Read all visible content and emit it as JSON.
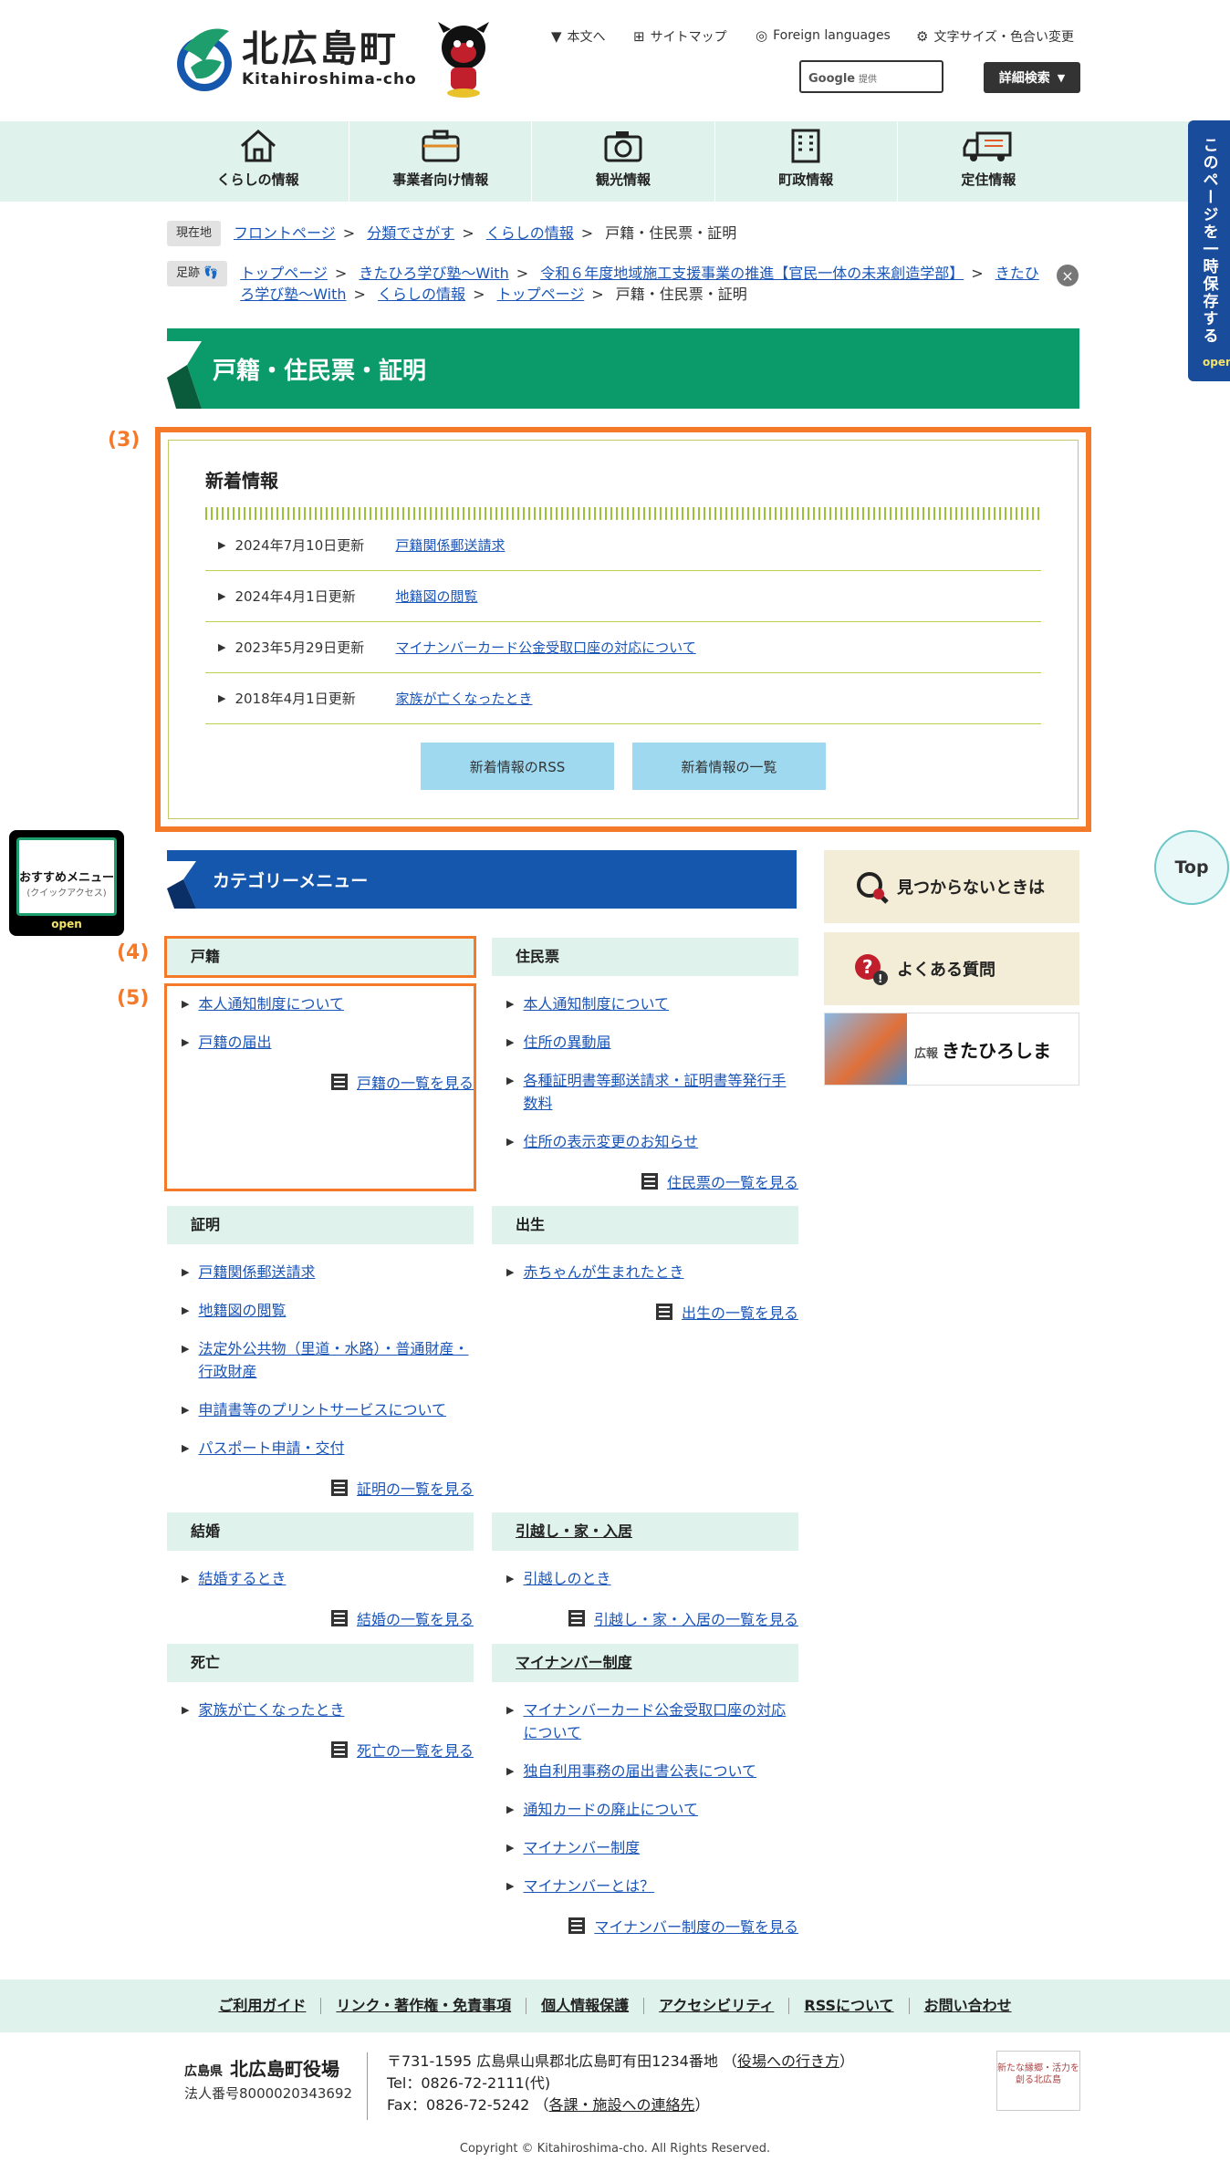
{
  "header": {
    "logo_jp": "北広島町",
    "logo_en": "Kitahiroshima-cho",
    "util_links": [
      {
        "label": "本文へ",
        "icon": "arrow-down-icon"
      },
      {
        "label": "サイトマップ",
        "icon": "sitemap-icon"
      },
      {
        "label": "Foreign languages",
        "icon": "globe-icon"
      },
      {
        "label": "文字サイズ・色合い変更",
        "icon": "gear-icon"
      }
    ],
    "search_logo": "Google",
    "search_provided": "提供",
    "advanced_search": "詳細検索"
  },
  "gnav": [
    {
      "label": "くらしの情報",
      "icon": "house-icon"
    },
    {
      "label": "事業者向け情報",
      "icon": "briefcase-icon"
    },
    {
      "label": "観光情報",
      "icon": "camera-icon"
    },
    {
      "label": "町政情報",
      "icon": "building-icon"
    },
    {
      "label": "定住情報",
      "icon": "truck-icon"
    }
  ],
  "save_tab": {
    "label": "このページを一時保存する",
    "open": "open"
  },
  "recommend": {
    "title": "おすすめメニュー",
    "sub": "(クイックアクセス)",
    "open": "open"
  },
  "top_button": "Top",
  "breadcrumb": {
    "tag": "現在地",
    "items": [
      "フロントページ",
      "分類でさがす",
      "くらしの情報",
      "戸籍・住民票・証明"
    ]
  },
  "footprint": {
    "tag": "足跡",
    "items": [
      "トップページ",
      "きたひろ学び塾～With",
      "令和６年度地域施工支援事業の推進【官民一体の未来創造学部】",
      "きたひろ学び塾～With",
      "くらしの情報",
      "トップページ",
      "戸籍・住民票・証明"
    ]
  },
  "page_title": "戸籍・住民票・証明",
  "annotations": {
    "a3": "(3)",
    "a4": "(4)",
    "a5": "(5)"
  },
  "news": {
    "title": "新着情報",
    "items": [
      {
        "date": "2024年7月10日更新",
        "title": "戸籍関係郵送請求"
      },
      {
        "date": "2024年4月1日更新",
        "title": "地籍図の閲覧"
      },
      {
        "date": "2023年5月29日更新",
        "title": "マイナンバーカード公金受取口座の対応について"
      },
      {
        "date": "2018年4月1日更新",
        "title": "家族が亡くなったとき"
      }
    ],
    "rss_button": "新着情報のRSS",
    "list_button": "新着情報の一覧"
  },
  "category": {
    "heading": "カテゴリーメニュー",
    "groups": {
      "koseki": {
        "title": "戸籍",
        "items": [
          "本人通知制度について",
          "戸籍の届出"
        ],
        "more": "戸籍の一覧を見る"
      },
      "juminhyo": {
        "title": "住民票",
        "items": [
          "本人通知制度について",
          "住所の異動届",
          "各種証明書等郵送請求・証明書等発行手数料",
          "住所の表示変更のお知らせ"
        ],
        "more": "住民票の一覧を見る"
      },
      "shomei": {
        "title": "証明",
        "items": [
          "戸籍関係郵送請求",
          "地籍図の閲覧",
          "法定外公共物（里道・水路）・普通財産・行政財産",
          "申請書等のプリントサービスについて",
          "パスポート申請・交付"
        ],
        "more": "証明の一覧を見る"
      },
      "shussei": {
        "title": "出生",
        "items": [
          "赤ちゃんが生まれたとき"
        ],
        "more": "出生の一覧を見る"
      },
      "kekkon": {
        "title": "結婚",
        "items": [
          "結婚するとき"
        ],
        "more": "結婚の一覧を見る"
      },
      "hikkoshi": {
        "title": "引越し・家・入居",
        "items": [
          "引越しのとき"
        ],
        "more": "引越し・家・入居の一覧を見る"
      },
      "shibo": {
        "title": "死亡",
        "items": [
          "家族が亡くなったとき"
        ],
        "more": "死亡の一覧を見る"
      },
      "mynumber": {
        "title": "マイナンバー制度",
        "items": [
          "マイナンバーカード公金受取口座の対応について",
          "独自利用事務の届出書公表について",
          "通知カードの廃止について",
          "マイナンバー制度",
          "マイナンバーとは？"
        ],
        "more": "マイナンバー制度の一覧を見る"
      }
    }
  },
  "banners": {
    "notfound": "見つからないときは",
    "faq": "よくある質問",
    "kouhou_small": "広報",
    "kouhou": "きたひろしま"
  },
  "footer_nav": [
    "ご利用ガイド",
    "リンク・著作権・免責事項",
    "個人情報保護",
    "アクセシビリティ",
    "RSSについて",
    "お問い合わせ"
  ],
  "footer": {
    "pref": "広島県",
    "office": "北広島町役場",
    "corp_no": "法人番号8000020343692",
    "address": "〒731-1595 広島県山県郡北広島町有田1234番地",
    "access_link": "役場への行き方",
    "tel": "Tel：0826-72-2111(代)",
    "fax": "Fax：0826-72-5242",
    "contact_link": "各課・施設への連絡先",
    "logo_text": "新たな縁郷・活力を創る北広島",
    "copyright": "Copyright © Kitahiroshima-cho. All Rights Reserved."
  }
}
